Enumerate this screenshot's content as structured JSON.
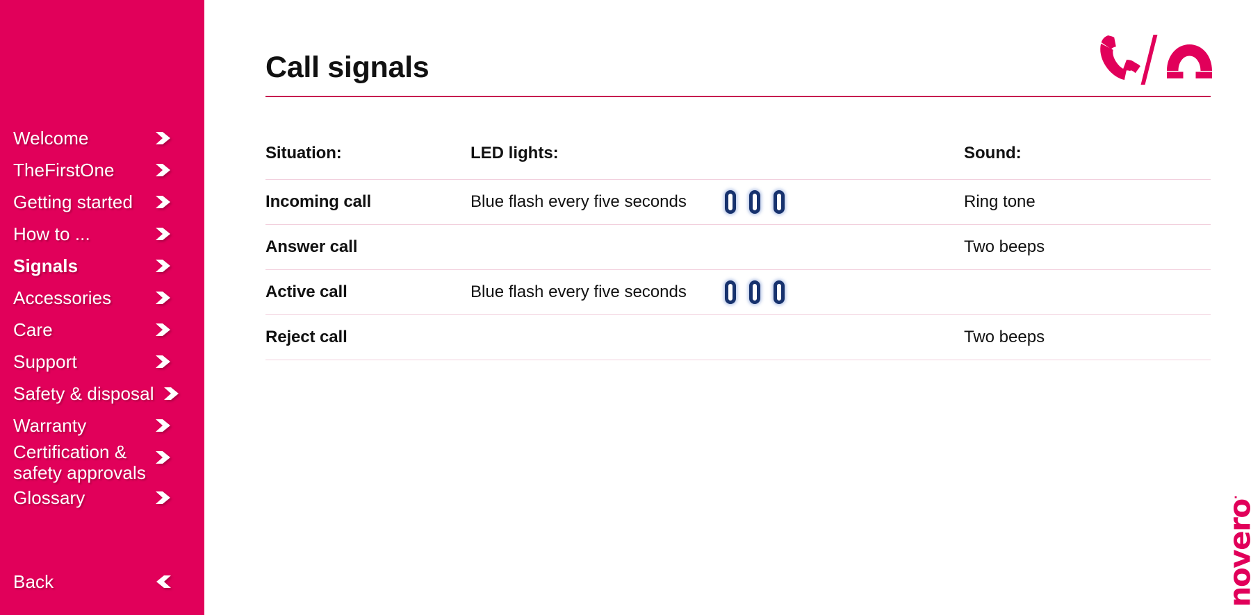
{
  "brand": {
    "accent_pink": "#e1005a",
    "rule_pink": "#c60050",
    "table_line": "#f2cfdd",
    "led_blue": "#17326e",
    "logo_text": "novero",
    "logo_mark": "·"
  },
  "sidebar": {
    "items": [
      {
        "label": "Welcome",
        "icon": "chevron-right-icon",
        "active": false
      },
      {
        "label": "TheFirstOne",
        "icon": "chevron-right-icon",
        "active": false
      },
      {
        "label": "Getting started",
        "icon": "chevron-right-icon",
        "active": false
      },
      {
        "label": "How to ...",
        "icon": "chevron-right-icon",
        "active": false
      },
      {
        "label": "Signals",
        "icon": "chevron-right-icon",
        "active": true
      },
      {
        "label": "Accessories",
        "icon": "chevron-right-icon",
        "active": false
      },
      {
        "label": "Care",
        "icon": "chevron-right-icon",
        "active": false
      },
      {
        "label": "Support",
        "icon": "chevron-right-icon",
        "active": false
      },
      {
        "label": "Safety & disposal",
        "icon": "chevron-right-icon",
        "active": false
      },
      {
        "label": "Warranty",
        "icon": "chevron-right-icon",
        "active": false
      },
      {
        "label": "Certification &\nsafety approvals",
        "icon": "chevron-right-icon",
        "active": false
      },
      {
        "label": "Glossary",
        "icon": "chevron-right-icon",
        "active": false
      }
    ],
    "back": {
      "label": "Back",
      "icon": "chevron-left-icon"
    }
  },
  "header": {
    "title": "Call signals",
    "icon": "call-handset-slash-hangup-icon"
  },
  "table": {
    "columns": [
      {
        "key": "situation",
        "label": "Situation:"
      },
      {
        "key": "led",
        "label": "LED lights:"
      },
      {
        "key": "sound",
        "label": "Sound:"
      }
    ],
    "rows": [
      {
        "situation": "Incoming call",
        "led": "Blue flash every five seconds",
        "led_indicators": 3,
        "sound": "Ring tone"
      },
      {
        "situation": "Answer call",
        "led": "",
        "led_indicators": 0,
        "sound": "Two beeps"
      },
      {
        "situation": "Active call",
        "led": "Blue flash every five seconds",
        "led_indicators": 3,
        "sound": ""
      },
      {
        "situation": "Reject call",
        "led": "",
        "led_indicators": 0,
        "sound": "Two beeps"
      }
    ]
  }
}
